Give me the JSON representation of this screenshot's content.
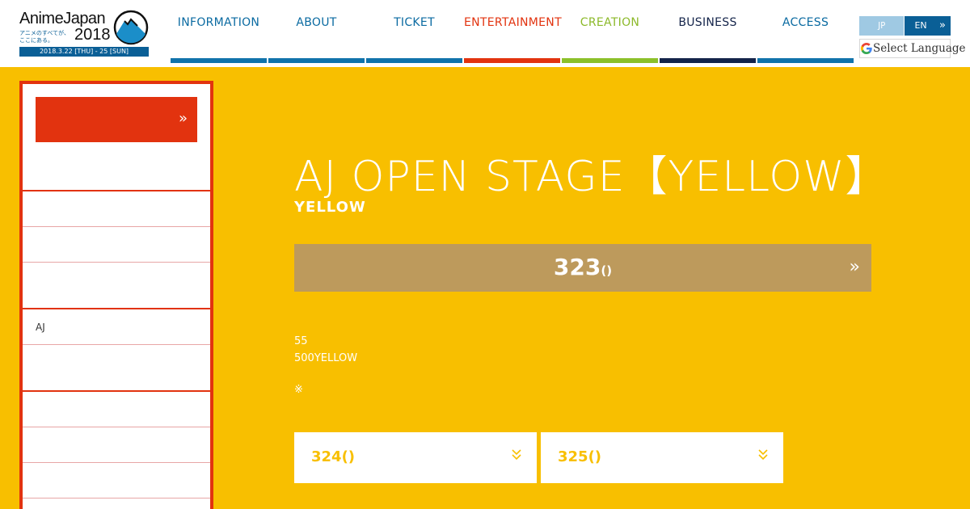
{
  "logo": {
    "title": "AnimeJapan",
    "subtitle": "アニメのすべてが、ここにある。",
    "year": "2018",
    "dates": "2018.3.22 [THU] - 25 [SUN]"
  },
  "nav": {
    "items": [
      {
        "label": "INFORMATION",
        "color": "#0a6aa1",
        "bar": "#1173ab"
      },
      {
        "label": "ABOUT",
        "color": "#0a6aa1",
        "bar": "#1173ab"
      },
      {
        "label": "TICKET",
        "color": "#0a6aa1",
        "bar": "#1173ab"
      },
      {
        "label": "ENTERTAINMENT",
        "color": "#e2330f",
        "bar": "#e2330f"
      },
      {
        "label": "CREATION",
        "color": "#8cb92a",
        "bar": "#8cc02a"
      },
      {
        "label": "BUSINESS",
        "color": "#14244a",
        "bar": "#14244a"
      },
      {
        "label": "ACCESS",
        "color": "#0a6aa1",
        "bar": "#1173ab"
      }
    ]
  },
  "lang": {
    "jp": "JP",
    "en": "EN",
    "en_arrow": "»",
    "translate": "Select Language"
  },
  "sidebar": {
    "button_arrow": "»",
    "items": [
      {
        "label": ""
      },
      {
        "label": ""
      },
      {
        "label": ""
      },
      {
        "label": "AJ"
      },
      {
        "label": ""
      },
      {
        "label": ""
      },
      {
        "label": ""
      },
      {
        "label": ""
      },
      {
        "label": ""
      }
    ]
  },
  "main": {
    "title": "AJ OPEN STAGE【YELLOW】",
    "subtitle": "YELLOW",
    "day_bar": {
      "label": "323",
      "suffix": "()",
      "arrow": "»"
    },
    "info": [
      "55",
      "500YELLOW"
    ],
    "note": "※",
    "day_cards": [
      {
        "label": "324()",
        "arrow": "»"
      },
      {
        "label": "325()",
        "arrow": "»"
      }
    ]
  },
  "colors": {
    "background": "#f8bf00",
    "accent_red": "#e2330f",
    "day_bar": "#bd9a5c",
    "brand_blue": "#0a5f96"
  }
}
